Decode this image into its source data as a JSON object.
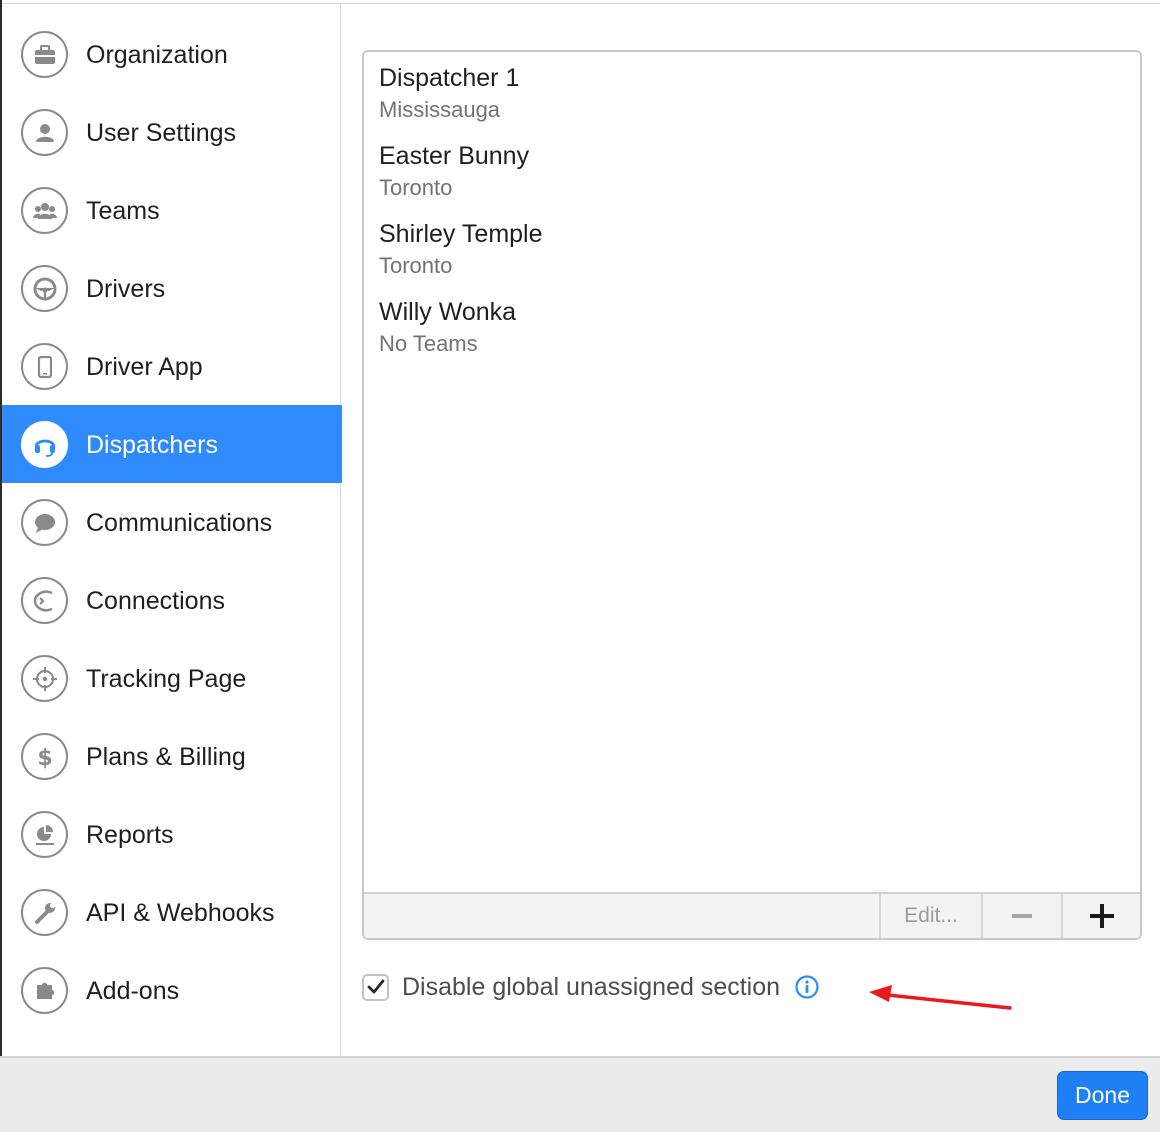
{
  "sidebar": {
    "items": [
      {
        "label": "Organization",
        "icon": "briefcase-icon"
      },
      {
        "label": "User Settings",
        "icon": "user-icon"
      },
      {
        "label": "Teams",
        "icon": "team-icon"
      },
      {
        "label": "Drivers",
        "icon": "steering-wheel-icon"
      },
      {
        "label": "Driver App",
        "icon": "phone-icon"
      },
      {
        "label": "Dispatchers",
        "icon": "headset-icon",
        "active": true
      },
      {
        "label": "Communications",
        "icon": "chat-bubble-icon"
      },
      {
        "label": "Connections",
        "icon": "connections-icon"
      },
      {
        "label": "Tracking Page",
        "icon": "crosshair-icon"
      },
      {
        "label": "Plans & Billing",
        "icon": "dollar-icon"
      },
      {
        "label": "Reports",
        "icon": "pie-chart-icon"
      },
      {
        "label": "API & Webhooks",
        "icon": "wrench-icon"
      },
      {
        "label": "Add-ons",
        "icon": "puzzle-icon"
      }
    ]
  },
  "dispatchers": [
    {
      "name": "Dispatcher 1",
      "team": "Mississauga"
    },
    {
      "name": "Easter Bunny",
      "team": "Toronto"
    },
    {
      "name": "Shirley Temple",
      "team": "Toronto"
    },
    {
      "name": "Willy Wonka",
      "team": "No Teams"
    }
  ],
  "toolbar": {
    "edit_label": "Edit...",
    "remove_icon": "minus-icon",
    "add_icon": "plus-icon"
  },
  "options": {
    "disable_unassigned_label": "Disable global unassigned section",
    "disable_unassigned_checked": true
  },
  "footer": {
    "done_label": "Done"
  },
  "colors": {
    "accent": "#2f8bfb",
    "done_button": "#1f7ff5",
    "info": "#2f8bfb",
    "annotation_arrow": "#e8191f"
  }
}
